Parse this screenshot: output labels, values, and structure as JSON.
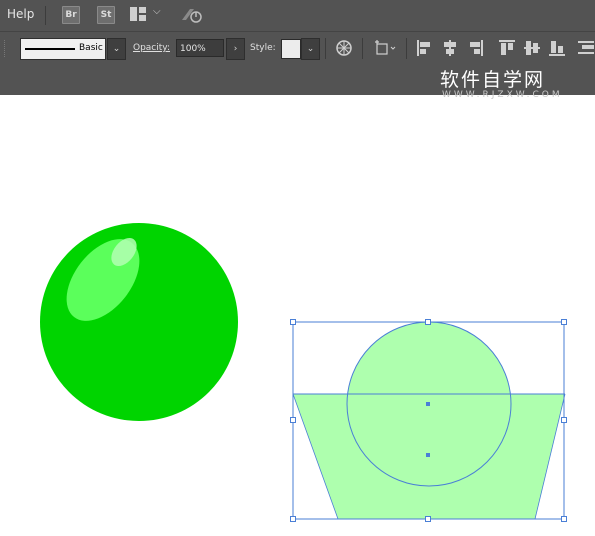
{
  "menu": {
    "help_label": "Help",
    "bridge_label": "Br",
    "stock_label": "St",
    "workspace_icon": "workspace-grid-icon",
    "gpu_icon": "gpu-performance-icon"
  },
  "control_bar": {
    "stroke_profile": "Basic",
    "opacity_label": "Opacity:",
    "opacity_value": "100%",
    "style_label": "Style:",
    "recolor_icon": "recolor-artwork-icon",
    "transform_icon": "transform-icon",
    "align_icons": [
      "align-left-icon",
      "align-horizontal-center-icon",
      "align-right-icon",
      "align-top-icon",
      "align-vertical-center-icon",
      "align-bottom-icon",
      "distribute-icon"
    ]
  },
  "watermark": {
    "title": "软件自学网",
    "url": "WWW.RJZXW.COM"
  },
  "canvas": {
    "ball_color": "#00d400",
    "ball_highlight_color": "#5bff5b",
    "selection_fill": "#aeffae",
    "selection_stroke": "#4a7fd6"
  }
}
